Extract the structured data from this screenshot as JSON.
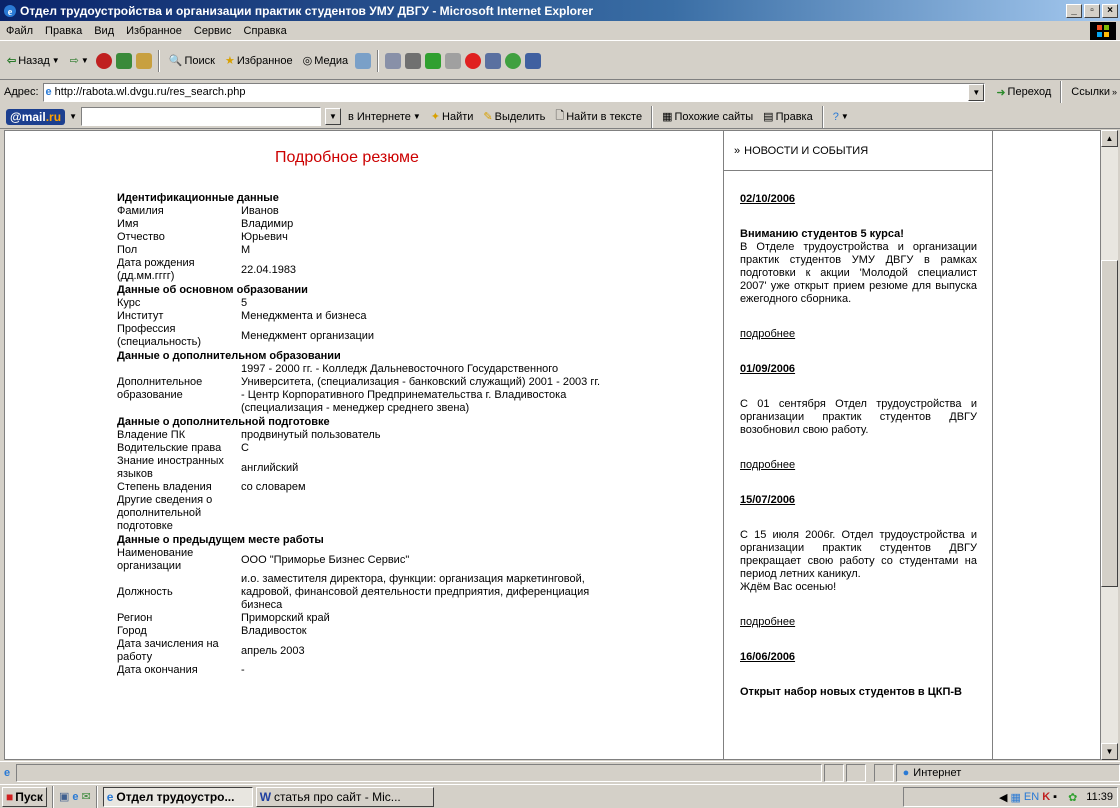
{
  "window": {
    "title": "Отдел трудоустройства и организации практик студентов УМУ ДВГУ - Microsoft Internet Explorer"
  },
  "menu": [
    "Файл",
    "Правка",
    "Вид",
    "Избранное",
    "Сервис",
    "Справка"
  ],
  "toolbar": {
    "back": "Назад",
    "search": "Поиск",
    "favorites": "Избранное",
    "media": "Медиа"
  },
  "address": {
    "label": "Адрес:",
    "url": "http://rabota.wl.dvgu.ru/res_search.php",
    "go": "Переход",
    "links": "Ссылки"
  },
  "mailbar": {
    "logo_mail": "@mail",
    "logo_ru": ".ru",
    "in_internet": "в Интернете",
    "find": "Найти",
    "highlight": "Выделить",
    "find_in_text": "Найти в тексте",
    "similar": "Похожие сайты",
    "edit": "Правка"
  },
  "resume": {
    "title": "Подробное резюме",
    "rows": [
      {
        "type": "section",
        "label": "Идентификационные данные"
      },
      {
        "label": "Фамилия",
        "value": "Иванов"
      },
      {
        "label": "Имя",
        "value": "Владимир"
      },
      {
        "label": "Отчество",
        "value": "Юрьевич"
      },
      {
        "label": "Пол",
        "value": "М"
      },
      {
        "label": "Дата рождения (дд.мм.гггг)",
        "value": "22.04.1983"
      },
      {
        "type": "section",
        "label": "Данные об основном образовании"
      },
      {
        "label": "Курс",
        "value": "5"
      },
      {
        "label": "Институт",
        "value": "Менеджмента и бизнеса"
      },
      {
        "label": "Профессия (специальность)",
        "value": "Менеджмент организации"
      },
      {
        "type": "section",
        "label": "Данные о дополнительном образовании"
      },
      {
        "label": "Дополнительное образование",
        "value": "1997 - 2000 гг. - Колледж Дальневосточного Государственного Университета, (специализация - банковский служащий) 2001 - 2003 гг. - Центр Корпоративного Предпринемательства г. Владивостока (специализация - менеджер среднего звена)"
      },
      {
        "type": "section",
        "label": "Данные о дополнительной подготовке"
      },
      {
        "label": "Владение ПК",
        "value": "продвинутый пользователь"
      },
      {
        "label": "Водительские права",
        "value": "С"
      },
      {
        "label": "Знание иностранных языков",
        "value": "английский"
      },
      {
        "label": "Степень владения",
        "value": "со словарем"
      },
      {
        "label": "Другие сведения о дополнительной подготовке",
        "value": ""
      },
      {
        "type": "section",
        "label": "Данные о предыдущем месте работы"
      },
      {
        "label": "Наименование организации",
        "value": "ООО \"Приморье Бизнес Сервис\""
      },
      {
        "label": "Должность",
        "value": "и.о. заместителя директора, функции: организация маркетинговой, кадровой, финансовой деятельности предприятия, диференциация бизнеса"
      },
      {
        "label": "Регион",
        "value": "Приморский край"
      },
      {
        "label": "Город",
        "value": "Владивосток"
      },
      {
        "label": "Дата зачисления на работу",
        "value": "апрель 2003"
      },
      {
        "label": "Дата окончания",
        "value": "-"
      }
    ]
  },
  "news": {
    "header": "НОВОСТИ И СОБЫТИЯ",
    "more": "подробнее",
    "items": [
      {
        "date": "02/10/2006",
        "title": "Вниманию студентов 5 курса!",
        "body": "В Отделе трудоустройства и организации практик студентов УМУ ДВГУ в рамках подготовки к акции 'Молодой специалист 2007' уже открыт прием резюме для выпуска ежегодного сборника."
      },
      {
        "date": "01/09/2006",
        "title": "",
        "body": "С 01 сентября Отдел трудоустройства и организации практик студентов ДВГУ возобновил свою работу."
      },
      {
        "date": "15/07/2006",
        "title": "",
        "body": "С 15 июля 2006г. Отдел трудоустройства и организации практик студентов ДВГУ прекращает свою работу со студентами на период летних каникул.",
        "body2": "Ждём Вас осенью!"
      },
      {
        "date": "16/06/2006",
        "title": "Открыт набор новых студентов в ЦКП-В",
        "body": ""
      }
    ]
  },
  "status": {
    "zone": "Интернет"
  },
  "taskbar": {
    "start": "Пуск",
    "task1": "Отдел трудоустро...",
    "task2": "статья про сайт - Mic...",
    "clock": "11:39"
  }
}
